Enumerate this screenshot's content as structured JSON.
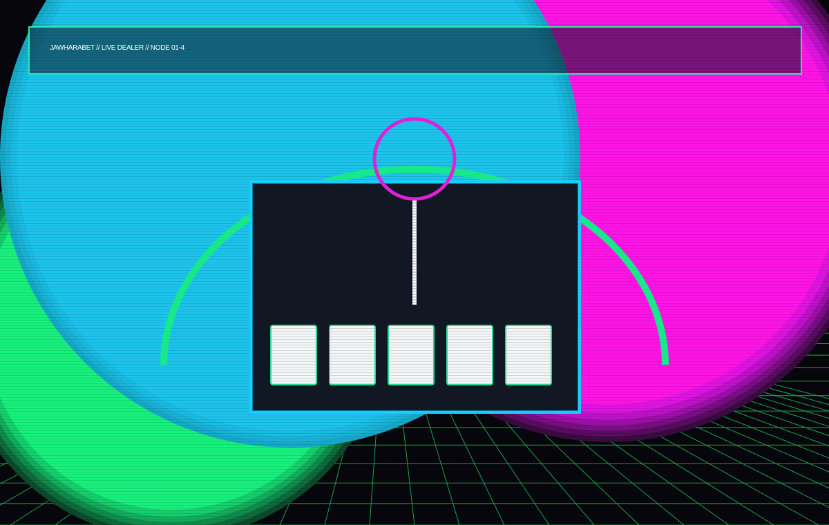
{
  "header": {
    "title": "JAWHARABET // LIVE DEALER // NODE 01-4"
  },
  "table": {
    "cards": [
      {
        "state": "face-down"
      },
      {
        "state": "face-down"
      },
      {
        "state": "face-down"
      },
      {
        "state": "face-down"
      },
      {
        "state": "face-down"
      }
    ]
  },
  "colors": {
    "green": "#17f07d",
    "cyan": "#1cc4ec",
    "magenta": "#ff14e6",
    "grid": "#1ec85a",
    "ring": "#e020d8",
    "panel_border": "#1ec9ff"
  }
}
